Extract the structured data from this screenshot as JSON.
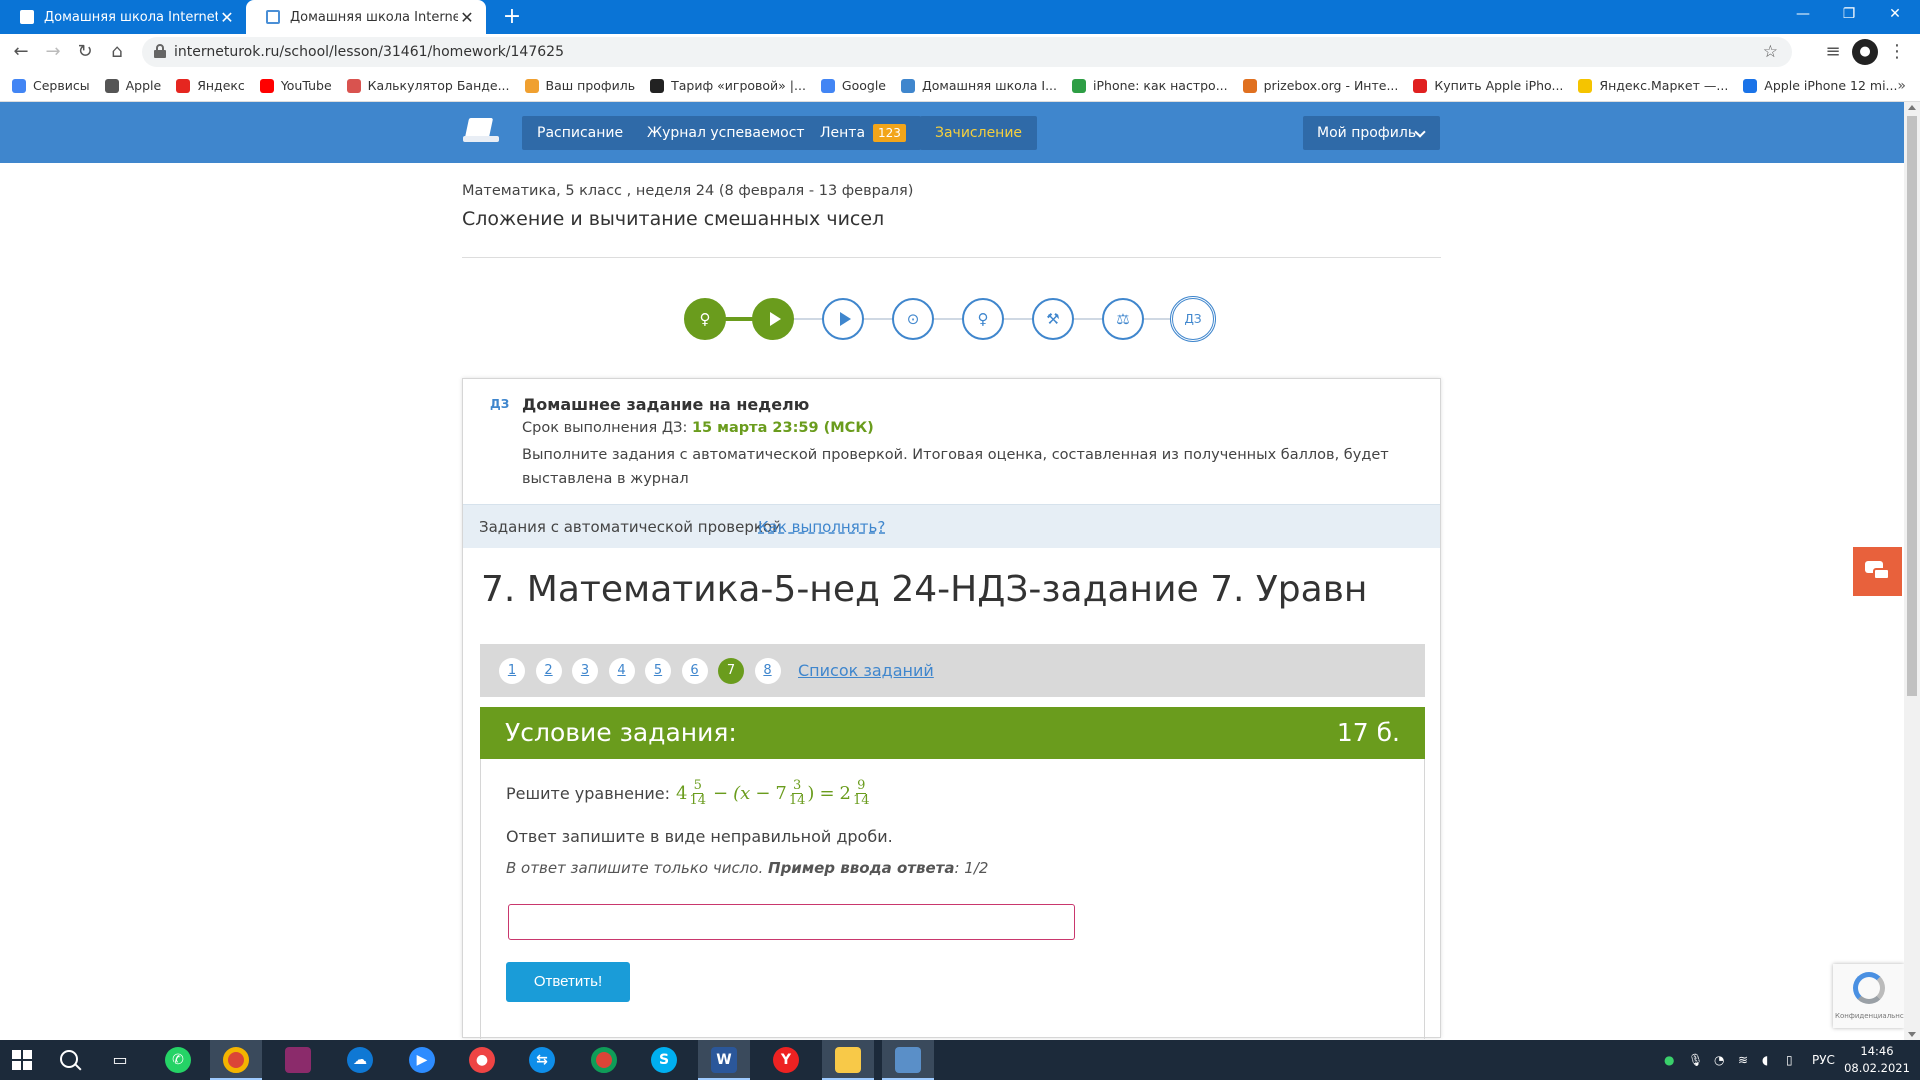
{
  "browser": {
    "tabs": [
      {
        "title": "Домашняя школа InternetUrok.r",
        "active": false
      },
      {
        "title": "Домашняя школа InternetUrok.r",
        "active": true
      }
    ],
    "url": "interneturok.ru/school/lesson/31461/homework/147625",
    "bookmarks": [
      {
        "label": "Сервисы",
        "color": "#4285f4"
      },
      {
        "label": "Apple",
        "color": "#555555"
      },
      {
        "label": "Яндекс",
        "color": "#e52620"
      },
      {
        "label": "YouTube",
        "color": "#ff0000"
      },
      {
        "label": "Калькулятор Банде...",
        "color": "#d9534f"
      },
      {
        "label": "Ваш профиль",
        "color": "#f0a030"
      },
      {
        "label": "Тариф «игровой» |...",
        "color": "#222222"
      },
      {
        "label": "Google",
        "color": "#4285f4"
      },
      {
        "label": "Домашняя школа I...",
        "color": "#3f86cd"
      },
      {
        "label": "iPhone: как настро...",
        "color": "#2e9e45"
      },
      {
        "label": "prizebox.org - Инте...",
        "color": "#e07020"
      },
      {
        "label": "Купить Apple iPho...",
        "color": "#e02020"
      },
      {
        "label": "Яндекс.Маркет —...",
        "color": "#f5c400"
      },
      {
        "label": "Apple iPhone 12 mi...",
        "color": "#1a73e8"
      }
    ]
  },
  "site": {
    "nav": {
      "schedule": "Расписание",
      "journal": "Журнал успеваемости",
      "feed": "Лента",
      "feed_count": "123",
      "enrollment": "Зачисление",
      "profile": "Мой профиль"
    },
    "breadcrumb": "Математика, 5 класс , неделя 24 (8 февраля - 13 февраля)",
    "lesson_title": "Сложение и вычитание смешанных чисел",
    "steps": {
      "homework_label": "ДЗ"
    },
    "homework": {
      "tag": "ДЗ",
      "title": "Домашнее задание на неделю",
      "deadline_label": "Срок выполнения ДЗ:",
      "deadline_value": "15 марта 23:59 (МСК)",
      "description": "Выполните задания с автоматической проверкой. Итоговая оценка, составленная из полученных баллов, будет выставлена в журнал"
    },
    "auto_check": {
      "label": "Задания с автоматической проверкой",
      "link": "Как выполнять?"
    },
    "task": {
      "title": "7. Математика-5-нед 24-НДЗ-задание 7. Уравн",
      "pages": [
        "1",
        "2",
        "3",
        "4",
        "5",
        "6",
        "7",
        "8"
      ],
      "active_page": 7,
      "list_link": "Список заданий",
      "condition_title": "Условие задания:",
      "score": "17 б.",
      "prompt": "Решите уравнение:",
      "equation": {
        "a_whole": "4",
        "a_num": "5",
        "a_den": "14",
        "minus": "−",
        "open": "(x",
        "minus2": "−",
        "b_whole": "7",
        "b_num": "3",
        "b_den": "14",
        "close": ")",
        "eq": "=",
        "c_whole": "2",
        "c_num": "9",
        "c_den": "14"
      },
      "answer_hint": "Ответ запишите в виде неправильной дроби.",
      "input_hint_plain": "В ответ запишите только число.",
      "input_hint_bold": "Пример ввода ответа",
      "input_hint_example": ": 1/2",
      "input_value": "",
      "submit": "Ответить!"
    },
    "recaptcha_text": "Конфиденциальнс"
  },
  "taskbar": {
    "language": "РУС",
    "time": "14:46",
    "date": "08.02.2021"
  }
}
